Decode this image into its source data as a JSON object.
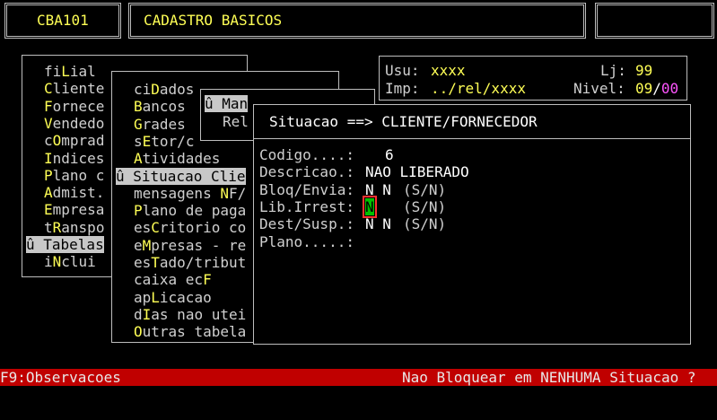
{
  "header": {
    "program_code": "CBA101",
    "screen_title": "CADASTRO BASICOS"
  },
  "info": {
    "usu_label": "Usu:",
    "usu_value": "xxxx",
    "lj_label": "Lj:",
    "lj_value": "99",
    "imp_label": "Imp:",
    "imp_value": "../rel/xxxx",
    "nivel_label": "Nivel:",
    "nivel_value": "09",
    "nivel_sep": "/",
    "nivel_value2": "00"
  },
  "menu_main": [
    {
      "pre": "fi",
      "hot": "L",
      "post": "ial"
    },
    {
      "pre": "",
      "hot": "C",
      "post": "liente"
    },
    {
      "pre": "",
      "hot": "F",
      "post": "ornece"
    },
    {
      "pre": "",
      "hot": "V",
      "post": "endedo"
    },
    {
      "pre": "c",
      "hot": "O",
      "post": "mprad"
    },
    {
      "pre": "",
      "hot": "I",
      "post": "ndices"
    },
    {
      "pre": "",
      "hot": "P",
      "post": "lano c"
    },
    {
      "pre": "",
      "hot": "A",
      "post": "dmist."
    },
    {
      "pre": "",
      "hot": "E",
      "post": "mpresa"
    },
    {
      "pre": "t",
      "hot": "R",
      "post": "anspo"
    },
    {
      "pre": "û Tabelas",
      "hot": "",
      "post": ""
    },
    {
      "pre": "i",
      "hot": "N",
      "post": "clui"
    }
  ],
  "menu_tabelas": [
    {
      "pre": "ci",
      "hot": "D",
      "post": "ados"
    },
    {
      "pre": "",
      "hot": "B",
      "post": "ancos"
    },
    {
      "pre": "",
      "hot": "G",
      "post": "rades"
    },
    {
      "pre": "s",
      "hot": "E",
      "post": "tor/c"
    },
    {
      "pre": "",
      "hot": "A",
      "post": "tividades"
    },
    {
      "pre": "û Situacao Clie",
      "hot": "",
      "post": ""
    },
    {
      "pre": "mensagens ",
      "hot": "N",
      "post": "F/"
    },
    {
      "pre": "",
      "hot": "P",
      "post": "lano de paga"
    },
    {
      "pre": "es",
      "hot": "C",
      "post": "ritorio co"
    },
    {
      "pre": "e",
      "hot": "M",
      "post": "presas - re"
    },
    {
      "pre": "es",
      "hot": "T",
      "post": "ado/tribut"
    },
    {
      "pre": "caixa ec",
      "hot": "F",
      "post": ""
    },
    {
      "pre": "ap",
      "hot": "L",
      "post": "icacao"
    },
    {
      "pre": "d",
      "hot": "I",
      "post": "as nao utei"
    },
    {
      "pre": "",
      "hot": "O",
      "post": "utras tabela"
    }
  ],
  "menu_situacao": [
    {
      "text": "û Man"
    },
    {
      "text": "Rel"
    }
  ],
  "dialog": {
    "title": "Situacao ==> CLIENTE/FORNECEDOR",
    "fields": [
      {
        "label": "Codigo....:",
        "value": "6",
        "suffix": ""
      },
      {
        "label": "Descricao.:",
        "value": "NAO LIBERADO",
        "suffix": ""
      },
      {
        "label": "Bloq/Envia:",
        "value": "N N",
        "suffix": "(S/N)"
      },
      {
        "label": "Lib.Irrest:",
        "value": "N",
        "suffix": "(S/N)"
      },
      {
        "label": "Dest/Susp.:",
        "value": "N N",
        "suffix": "(S/N)"
      },
      {
        "label": "Plano.....:",
        "value": "",
        "suffix": ""
      }
    ]
  },
  "status_bar": {
    "left": "F9:Observacoes",
    "right": "Nao Bloquear em NENHUMA Situacao ?"
  },
  "colors": {
    "hotkey": "#ffff55",
    "status_bg": "#c00000",
    "active_field_bg": "#00c000",
    "active_field_border": "#ff3030",
    "nivel_accent": "#ff55ff"
  }
}
